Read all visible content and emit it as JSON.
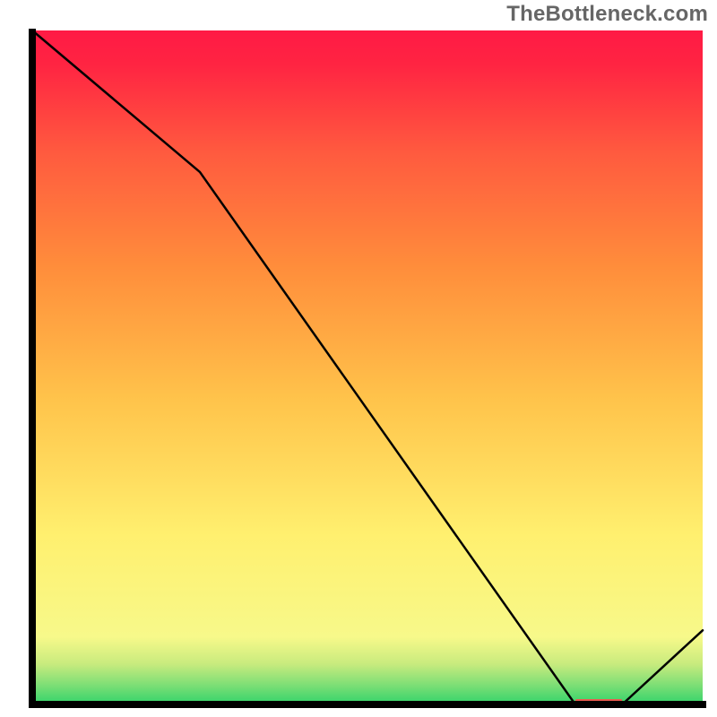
{
  "watermark": "TheBottleneck.com",
  "chart_data": {
    "type": "line",
    "title": "",
    "xlabel": "",
    "ylabel": "",
    "xlim": [
      0,
      100
    ],
    "ylim": [
      0,
      100
    ],
    "grid": false,
    "legend": false,
    "series": [
      {
        "name": "curve",
        "x": [
          0,
          25,
          81,
          88,
          100
        ],
        "values": [
          100,
          79,
          0,
          0,
          11
        ]
      }
    ],
    "gradient_stops": [
      {
        "offset": 0.0,
        "color": "#32d36b"
      },
      {
        "offset": 0.03,
        "color": "#80df76"
      },
      {
        "offset": 0.06,
        "color": "#c8eb7e"
      },
      {
        "offset": 0.1,
        "color": "#f7f98a"
      },
      {
        "offset": 0.25,
        "color": "#fff06f"
      },
      {
        "offset": 0.45,
        "color": "#ffc44b"
      },
      {
        "offset": 0.65,
        "color": "#ff8d3b"
      },
      {
        "offset": 0.82,
        "color": "#ff5a3f"
      },
      {
        "offset": 0.95,
        "color": "#ff2442"
      },
      {
        "offset": 1.0,
        "color": "#ff1a45"
      }
    ],
    "marker": {
      "x_range": [
        81,
        88
      ],
      "color": "#e85b4f"
    },
    "axes_color": "#000000"
  }
}
